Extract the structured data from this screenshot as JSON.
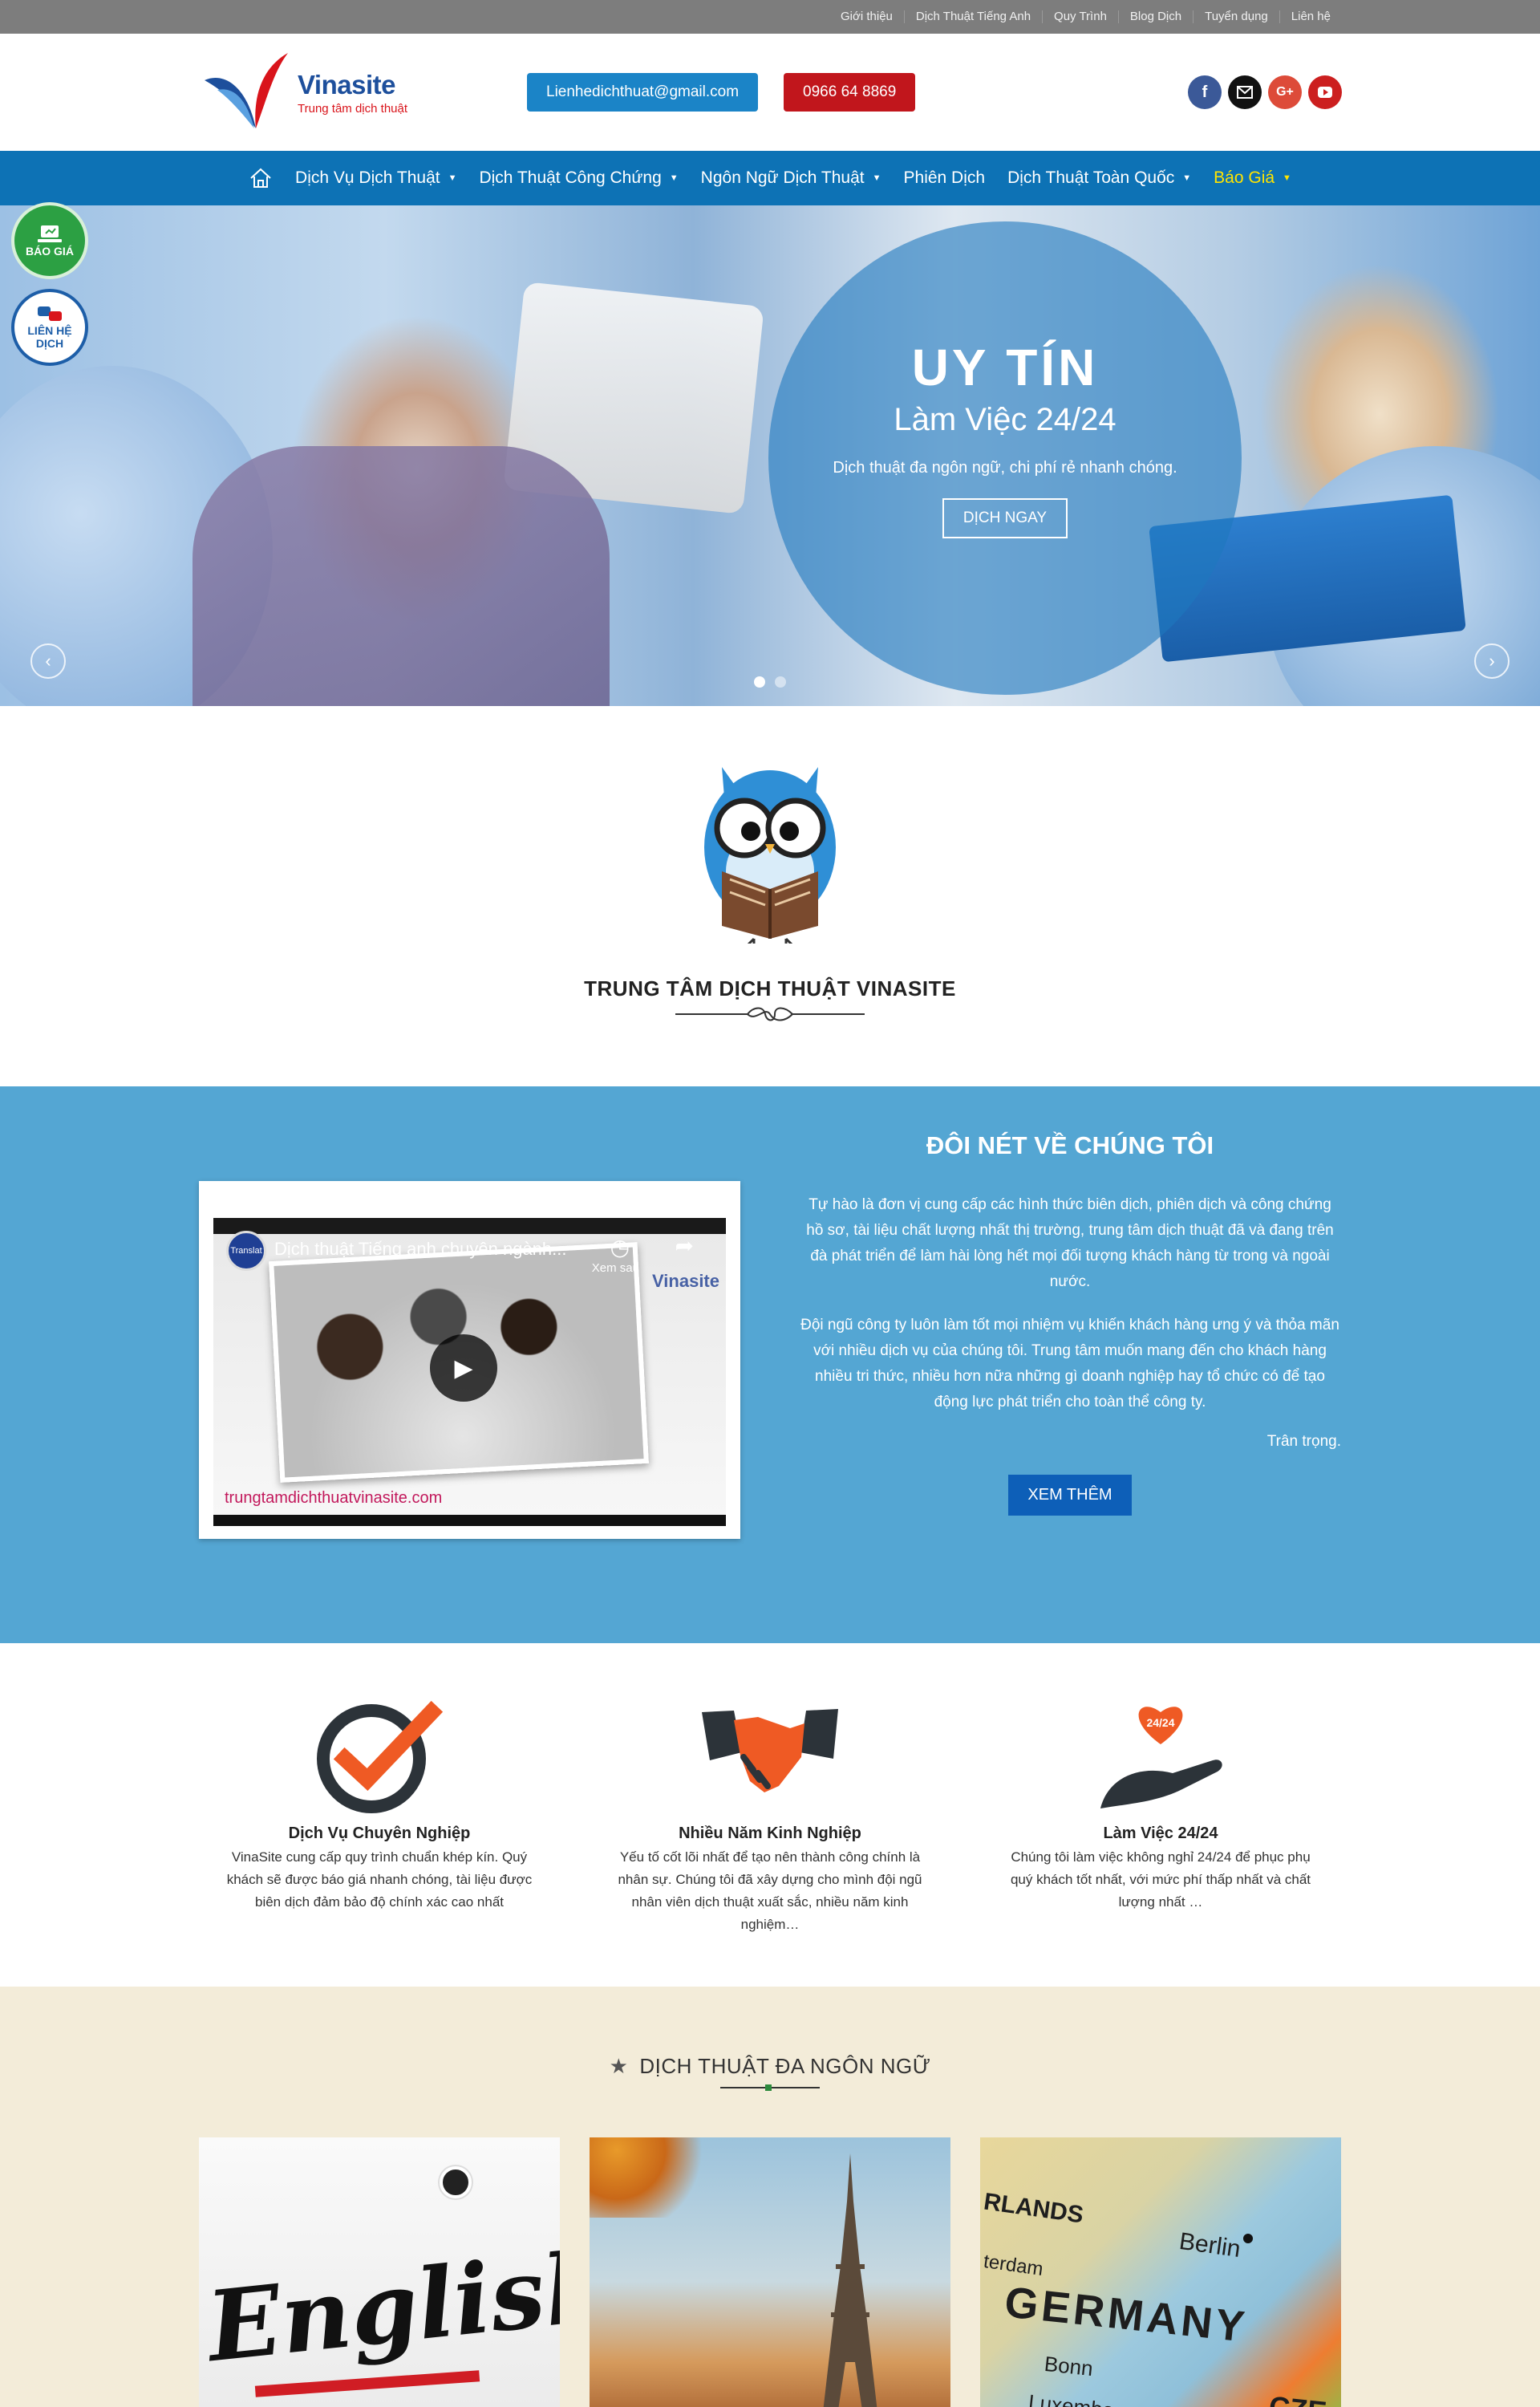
{
  "topbar": {
    "links": [
      "Giới thiệu",
      "Dịch Thuật Tiếng Anh",
      "Quy Trình",
      "Blog Dịch",
      "Tuyển dụng",
      "Liên hệ"
    ]
  },
  "header": {
    "logo_name": "Vinasite",
    "logo_tagline": "Trung tâm dịch thuật",
    "email": "Lienhedichthuat@gmail.com",
    "phone": "0966 64 8869",
    "social_icons": [
      "facebook-icon",
      "email-icon",
      "google-plus-icon",
      "youtube-icon"
    ],
    "colors": {
      "email_btn": "#1b84c7",
      "phone_btn": "#c1161c"
    }
  },
  "nav": {
    "items": [
      {
        "label": "Dịch Vụ Dịch Thuật",
        "dropdown": true
      },
      {
        "label": "Dịch Thuật Công Chứng",
        "dropdown": true
      },
      {
        "label": "Ngôn Ngữ Dịch Thuật",
        "dropdown": true
      },
      {
        "label": "Phiên Dịch",
        "dropdown": false
      },
      {
        "label": "Dịch Thuật Toàn Quốc",
        "dropdown": true
      },
      {
        "label": "Báo Giá",
        "dropdown": true,
        "active": true
      }
    ],
    "color": "#0d72b5",
    "active_color": "#ffe400"
  },
  "floating": {
    "quote": "BÁO GIÁ",
    "contact_line1": "LIÊN HỆ",
    "contact_line2": "DỊCH"
  },
  "hero": {
    "title": "UY TÍN",
    "subtitle": "Làm Việc 24/24",
    "description": "Dịch thuật đa ngôn ngữ, chi phí rẻ nhanh chóng.",
    "button": "DỊCH NGAY",
    "slides": 2,
    "current_slide": 1
  },
  "intro": {
    "title": "TRUNG TÂM DỊCH THUẬT VINASITE"
  },
  "about": {
    "title": "ĐÔI NÉT VỀ CHÚNG TÔI",
    "paragraph1": "Tự hào là đơn vị cung cấp các hình thức biên dịch, phiên dịch và công chứng hồ sơ, tài liệu chất lượng nhất thị trường, trung tâm dịch thuật đã và đang trên đà phát triển để làm hài lòng hết mọi đối tượng khách hàng từ trong và ngoài nước.",
    "paragraph2": "Đội ngũ công ty luôn làm tốt mọi nhiệm vụ khiến khách hàng ưng ý và thỏa mãn với nhiều dịch vụ của chúng tôi. Trung tâm muốn mang đến cho khách hàng nhiều tri thức, nhiều hơn nữa những gì doanh nghiệp hay tổ chức có để tạo động lực phát triển cho toàn thể công ty.",
    "signature": "Trân trọng.",
    "button": "XEM THÊM",
    "video": {
      "title": "Dịch thuật Tiếng anh chuyên ngành...",
      "watch_later": "Xem sau",
      "url": "trungtamdichthuatvinasite.com",
      "channel_badge": "Translat",
      "brand": "Vinasite"
    },
    "bg_color": "#54a6d3"
  },
  "features": [
    {
      "icon": "checkmark-icon",
      "title": "Dịch Vụ Chuyên Nghiệp",
      "desc_lines": [
        "VinaSite cung cấp quy trình chuẩn khép kín. Quý",
        "khách sẽ được báo giá nhanh chóng, tài liệu được",
        "biên dịch đảm bảo độ chính xác cao nhất"
      ]
    },
    {
      "icon": "handshake-icon",
      "title": "Nhiều Năm Kinh Nghiệp",
      "desc_lines": [
        "Yếu tố cốt lõi nhất để tạo nên thành công chính là",
        "nhân sự. Chúng tôi đã xây dựng cho mình đội ngũ",
        "nhân viên dịch thuật xuất sắc, nhiều năm kinh",
        "nghiệm…"
      ]
    },
    {
      "icon": "heart-hand-icon",
      "title": "Làm Việc 24/24",
      "badge": "24/24",
      "desc_lines": [
        "Chúng tôi làm việc không nghỉ 24/24 để phục phụ",
        "quý khách tốt nhất, với mức phí thấp nhất và chất",
        "lượng nhất …"
      ]
    }
  ],
  "languages": {
    "title": "DỊCH THUẬT ĐA NGÔN NGỮ",
    "cards": [
      {
        "name": "english-card",
        "text": "English"
      },
      {
        "name": "french-card"
      },
      {
        "name": "german-card",
        "labels": [
          "RLANDS",
          "Berlin",
          "terdam",
          "GERMANY",
          "Bonn",
          "Luxembourg",
          "CZE"
        ]
      }
    ]
  }
}
